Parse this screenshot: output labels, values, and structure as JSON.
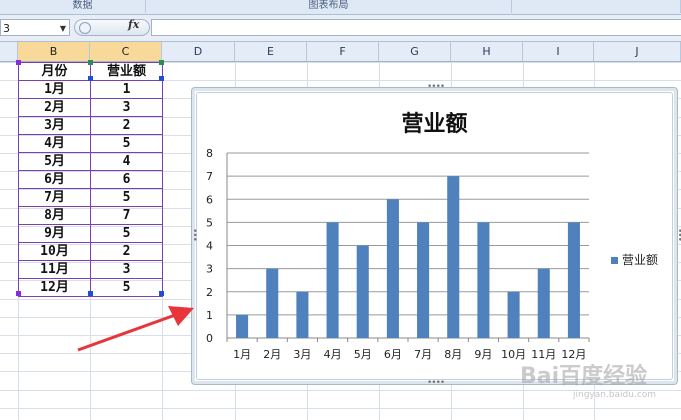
{
  "ribbon": {
    "groups": [
      "数据",
      "图表布局"
    ]
  },
  "formula_bar": {
    "name_box": "3",
    "fx_label": "fx"
  },
  "columns": [
    "B",
    "C",
    "D",
    "E",
    "F",
    "G",
    "H",
    "I",
    "J"
  ],
  "table": {
    "header": [
      "月份",
      "营业额"
    ],
    "rows": [
      [
        "1月",
        "1"
      ],
      [
        "2月",
        "3"
      ],
      [
        "3月",
        "2"
      ],
      [
        "4月",
        "5"
      ],
      [
        "5月",
        "4"
      ],
      [
        "6月",
        "6"
      ],
      [
        "7月",
        "5"
      ],
      [
        "8月",
        "7"
      ],
      [
        "9月",
        "5"
      ],
      [
        "10月",
        "2"
      ],
      [
        "11月",
        "3"
      ],
      [
        "12月",
        "5"
      ]
    ]
  },
  "chart_data": {
    "type": "bar",
    "title": "营业额",
    "categories": [
      "1月",
      "2月",
      "3月",
      "4月",
      "5月",
      "6月",
      "7月",
      "8月",
      "9月",
      "10月",
      "11月",
      "12月"
    ],
    "series": [
      {
        "name": "营业额",
        "values": [
          1,
          3,
          2,
          5,
          4,
          6,
          5,
          7,
          5,
          2,
          3,
          5
        ],
        "color": "#4f81bd"
      }
    ],
    "ylim": [
      0,
      8
    ],
    "yticks": [
      0,
      1,
      2,
      3,
      4,
      5,
      6,
      7,
      8
    ],
    "grid": true,
    "legend": "right"
  },
  "watermark": {
    "main": "Bai百度经验",
    "sub": "jingyan.baidu.com"
  }
}
